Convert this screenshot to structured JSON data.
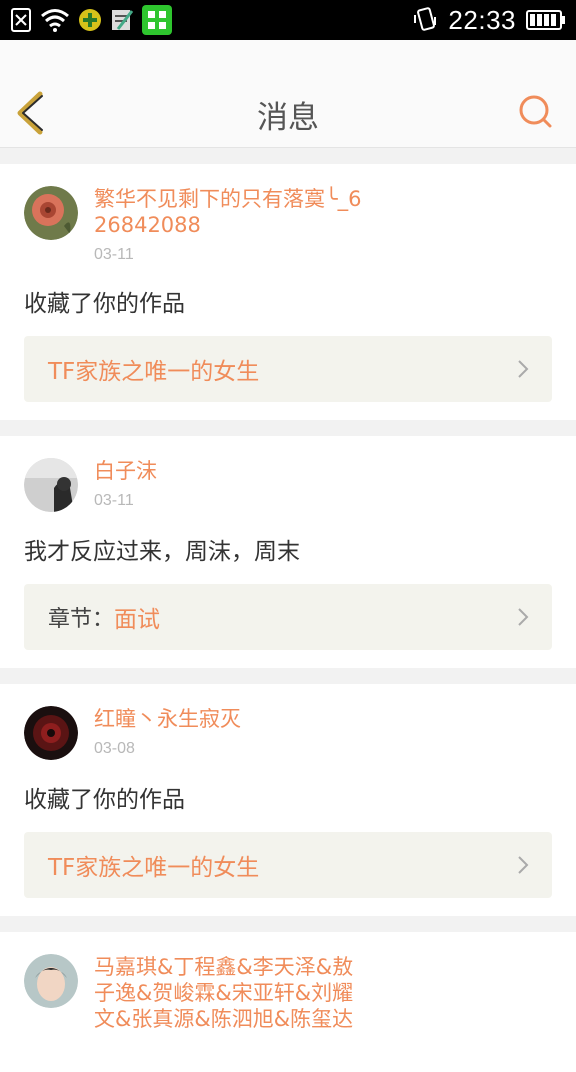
{
  "status_bar": {
    "time": "22:33",
    "icons": [
      "sim-off-icon",
      "wifi-icon",
      "plus-app-icon",
      "notepad-icon",
      "grid-app-icon",
      "vibrate-icon",
      "battery-icon"
    ]
  },
  "header": {
    "title": "消息",
    "back_icon": "chevron-left-icon",
    "search_icon": "search-icon"
  },
  "colors": {
    "accent": "#f08c5a",
    "back": "#c9a23a",
    "ref_bg": "#f3f3ed"
  },
  "messages": [
    {
      "username": "繁华不见剩下的只有落寞╰_626842088",
      "date": "03-11",
      "action": "收藏了你的作品",
      "ref_prefix": "",
      "ref_title": "TF家族之唯一的女生"
    },
    {
      "username": "白子沫",
      "date": "03-11",
      "action": "我才反应过来，周沫，周末",
      "ref_prefix": "章节：",
      "ref_title": "面试"
    },
    {
      "username": "红瞳丶永生寂灭",
      "date": "03-08",
      "action": "收藏了你的作品",
      "ref_prefix": "",
      "ref_title": "TF家族之唯一的女生"
    },
    {
      "username": "马嘉琪&丁程鑫&李天泽&敖子逸&贺峻霖&宋亚轩&刘耀文&张真源&陈泗旭&陈玺达"
    }
  ]
}
